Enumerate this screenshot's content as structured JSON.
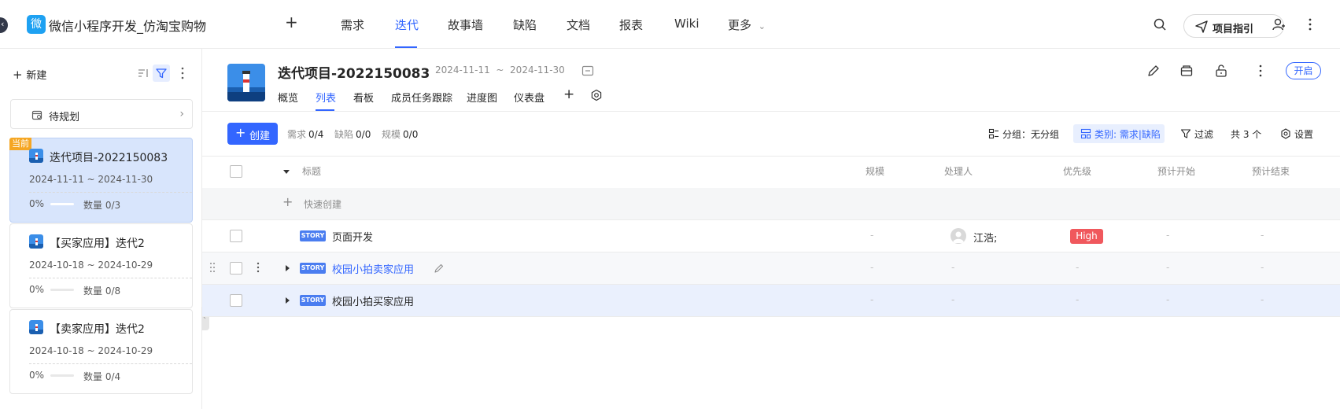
{
  "app": {
    "logo_char": "微",
    "title": "微信小程序开发_仿淘宝购物"
  },
  "nav": [
    {
      "label": "需求"
    },
    {
      "label": "迭代"
    },
    {
      "label": "故事墙"
    },
    {
      "label": "缺陷"
    },
    {
      "label": "文档"
    },
    {
      "label": "报表"
    },
    {
      "label": "Wiki"
    },
    {
      "label": "更多"
    }
  ],
  "nav_active": "迭代",
  "guide_button": "项目指引",
  "sidebar": {
    "new_label": "新建",
    "backlog_label": "待规划",
    "current_tag": "当前",
    "iterations": [
      {
        "name": "迭代项目-2022150083",
        "dates": "2024-11-11 ~ 2024-11-30",
        "progress": "0%",
        "count": "数量 0/3"
      },
      {
        "name": "【买家应用】迭代2",
        "dates": "2024-10-18 ~ 2024-10-29",
        "progress": "0%",
        "count": "数量 0/8"
      },
      {
        "name": "【卖家应用】迭代2",
        "dates": "2024-10-18 ~ 2024-10-29",
        "progress": "0%",
        "count": "数量 0/4"
      }
    ]
  },
  "iteration": {
    "title": "迭代项目-2022150083",
    "dates": "2024-11-11  ~  2024-11-30",
    "status_button": "开启",
    "tabs": [
      {
        "label": "概览"
      },
      {
        "label": "列表"
      },
      {
        "label": "看板"
      },
      {
        "label": "成员任务跟踪"
      },
      {
        "label": "进度图"
      },
      {
        "label": "仪表盘"
      }
    ]
  },
  "toolbar": {
    "create_label": "创建",
    "stats": [
      {
        "k": "需求",
        "v": "0/4"
      },
      {
        "k": "缺陷",
        "v": "0/0"
      },
      {
        "k": "规模",
        "v": "0/0"
      }
    ],
    "group_label": "分组：无分组",
    "type_label": "类别: 需求|缺陷",
    "filter_label": "过滤",
    "total_label": "共 3 个",
    "settings_label": "设置"
  },
  "table": {
    "headers": {
      "title": "标题",
      "scale": "规模",
      "assignee": "处理人",
      "priority": "优先级",
      "plan_start": "预计开始",
      "plan_end": "预计结束"
    },
    "quick_create": "快速创建",
    "story_tag": "STORY",
    "dash": "-",
    "rows": [
      {
        "title": "页面开发",
        "assignee": "江浩;",
        "priority": "High"
      },
      {
        "title": "校园小拍卖家应用"
      },
      {
        "title": "校园小拍买家应用"
      }
    ]
  },
  "colors": {
    "accent": "#3366ff",
    "priority_high": "#f0585d",
    "current_tag": "#f5a623"
  }
}
